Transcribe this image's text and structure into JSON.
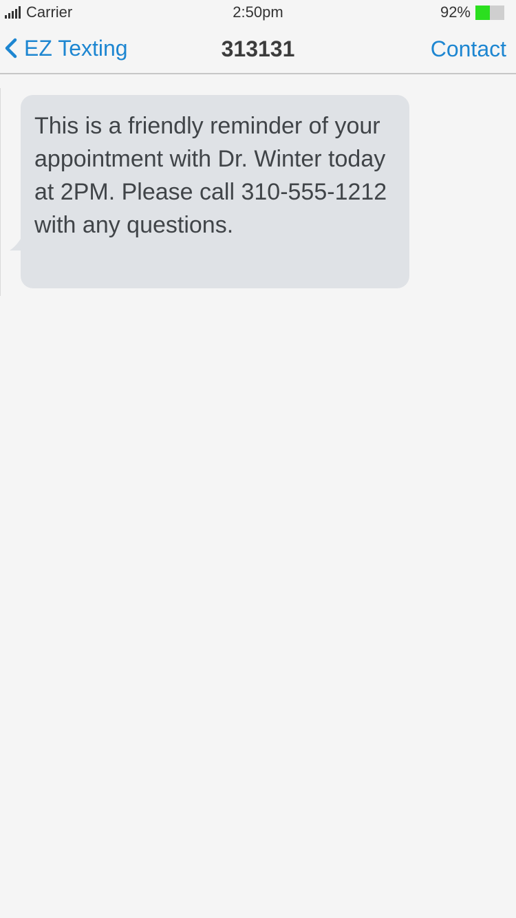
{
  "status_bar": {
    "carrier": "Carrier",
    "time": "2:50pm",
    "battery_percent": "92%",
    "battery_level": 0.5,
    "signal_icon": "signal-bars-icon",
    "battery_icon": "battery-icon",
    "battery_color": "#2bdf1f"
  },
  "nav": {
    "back_label": "EZ Texting",
    "back_icon": "chevron-left-icon",
    "title": "313131",
    "contact_label": "Contact",
    "accent_color": "#1d86d1"
  },
  "messages": [
    {
      "direction": "incoming",
      "text": "This is a friendly reminder of your appointment with Dr. Winter today at 2PM. Please call 310-555-1212 with any questions.",
      "bubble_color": "#dfe2e6"
    }
  ]
}
